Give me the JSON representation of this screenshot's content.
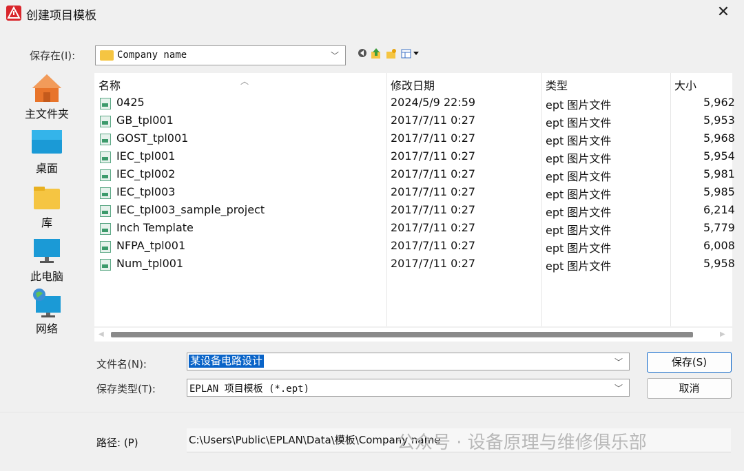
{
  "window": {
    "title": "创建项目模板",
    "close_glyph": "✕"
  },
  "save_in": {
    "label": "保存在(I):",
    "value": "Company name"
  },
  "toolbar": {
    "icons": [
      "back-icon",
      "up-folder-icon",
      "new-folder-icon",
      "view-menu-icon"
    ]
  },
  "places": [
    {
      "label": "主文件夹",
      "icon": "home-icon"
    },
    {
      "label": "桌面",
      "icon": "desktop-icon"
    },
    {
      "label": "库",
      "icon": "library-icon"
    },
    {
      "label": "此电脑",
      "icon": "computer-icon"
    },
    {
      "label": "网络",
      "icon": "network-icon"
    }
  ],
  "columns": [
    "名称",
    "修改日期",
    "类型",
    "大小"
  ],
  "files": [
    {
      "name": "0425",
      "date": "2024/5/9 22:59",
      "type": "ept 图片文件",
      "size": "5,962"
    },
    {
      "name": "GB_tpl001",
      "date": "2017/7/11 0:27",
      "type": "ept 图片文件",
      "size": "5,953"
    },
    {
      "name": "GOST_tpl001",
      "date": "2017/7/11 0:27",
      "type": "ept 图片文件",
      "size": "5,968"
    },
    {
      "name": "IEC_tpl001",
      "date": "2017/7/11 0:27",
      "type": "ept 图片文件",
      "size": "5,954"
    },
    {
      "name": "IEC_tpl002",
      "date": "2017/7/11 0:27",
      "type": "ept 图片文件",
      "size": "5,981"
    },
    {
      "name": "IEC_tpl003",
      "date": "2017/7/11 0:27",
      "type": "ept 图片文件",
      "size": "5,985"
    },
    {
      "name": "IEC_tpl003_sample_project",
      "date": "2017/7/11 0:27",
      "type": "ept 图片文件",
      "size": "6,214"
    },
    {
      "name": "Inch Template",
      "date": "2017/7/11 0:27",
      "type": "ept 图片文件",
      "size": "5,779"
    },
    {
      "name": "NFPA_tpl001",
      "date": "2017/7/11 0:27",
      "type": "ept 图片文件",
      "size": "6,008"
    },
    {
      "name": "Num_tpl001",
      "date": "2017/7/11 0:27",
      "type": "ept 图片文件",
      "size": "5,958"
    }
  ],
  "filename": {
    "label": "文件名(N):",
    "value": "某设备电路设计"
  },
  "filetype": {
    "label": "保存类型(T):",
    "value": "EPLAN 项目模板 (*.ept)"
  },
  "buttons": {
    "save": "保存(S)",
    "cancel": "取消"
  },
  "path": {
    "label": "路径: (P)",
    "value": "C:\\Users\\Public\\EPLAN\\Data\\模板\\Company name"
  },
  "watermark": "公众号 · 设备原理与维修俱乐部",
  "colors": {
    "accent": "#0a64c8",
    "app_icon": "#d9262c"
  }
}
